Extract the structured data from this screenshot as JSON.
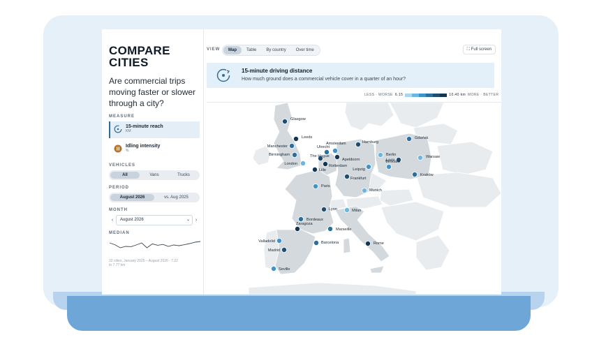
{
  "page": {
    "title": "COMPARE CITIES",
    "question": "Are commercial trips moving faster or slower through a city?"
  },
  "measure": {
    "label": "MEASURE",
    "items": [
      {
        "name": "15-minute reach",
        "unit": "KM",
        "active": true,
        "icon": "clock-arrow-icon",
        "color": "#2f6d99"
      },
      {
        "name": "Idling intensity",
        "unit": "%",
        "active": false,
        "icon": "pause-icon",
        "color": "#b8742a"
      }
    ]
  },
  "vehicles": {
    "label": "VEHICLES",
    "options": [
      "All",
      "Vans",
      "Trucks"
    ],
    "selected": "All"
  },
  "period": {
    "label": "PERIOD",
    "options": [
      "August 2026",
      "vs. Aug 2025"
    ],
    "selected": "August 2026"
  },
  "month": {
    "label": "MONTH",
    "value": "August 2026",
    "prev": "‹",
    "next": "›",
    "dropdown": "⌄"
  },
  "median": {
    "label": "MEDIAN",
    "note": "32 cities, January 2025 – August 2026 · 7.22 to 7.77 km",
    "trend": [
      0.35,
      0.48,
      0.7,
      0.6,
      0.62,
      0.5,
      0.35,
      0.7,
      0.42,
      0.52,
      0.46,
      0.6,
      0.5,
      0.55,
      0.48,
      0.4,
      0.3,
      0.25
    ]
  },
  "view": {
    "label": "VIEW",
    "tabs": [
      "Map",
      "Table",
      "By country",
      "Over time"
    ],
    "selected": "Map",
    "fullscreen": "Full screen"
  },
  "banner": {
    "title": "15-minute driving distance",
    "description": "How much ground does a commercial vehicle cover in a quarter of an hour?"
  },
  "legend": {
    "left": "LESS · WORSE",
    "min": "6.15",
    "max": "10.40 km",
    "right": "MORE · BETTER",
    "colors": [
      "#a9d6ef",
      "#6cb7e2",
      "#3e93c8",
      "#2b6f9c",
      "#1d4e72",
      "#123652"
    ]
  },
  "cities": [
    {
      "name": "Glasgow",
      "level": 4
    },
    {
      "name": "Leeds",
      "level": 5
    },
    {
      "name": "Manchester",
      "level": 3
    },
    {
      "name": "Birmingham",
      "level": 3
    },
    {
      "name": "London",
      "level": 1
    },
    {
      "name": "Utrecht",
      "level": 3
    },
    {
      "name": "Amsterdam",
      "level": 2
    },
    {
      "name": "The Hague",
      "level": 4
    },
    {
      "name": "Rotterdam",
      "level": 5
    },
    {
      "name": "Apeldoorn",
      "level": 5
    },
    {
      "name": "Lille",
      "level": 5
    },
    {
      "name": "Hamburg",
      "level": 4
    },
    {
      "name": "Berlin",
      "level": 1
    },
    {
      "name": "Gdańsk",
      "level": 3
    },
    {
      "name": "Łódź",
      "level": 4
    },
    {
      "name": "Warsaw",
      "level": 1
    },
    {
      "name": "Wrocław",
      "level": 2
    },
    {
      "name": "Leipzig",
      "level": 2
    },
    {
      "name": "Kraków",
      "level": 3
    },
    {
      "name": "Frankfurt",
      "level": 4
    },
    {
      "name": "Paris",
      "level": 2
    },
    {
      "name": "Munich",
      "level": 1
    },
    {
      "name": "Lyon",
      "level": 4
    },
    {
      "name": "Milan",
      "level": 1
    },
    {
      "name": "Bordeaux",
      "level": 3
    },
    {
      "name": "Marseille",
      "level": 3
    },
    {
      "name": "Rome",
      "level": 5
    },
    {
      "name": "Zaragoza",
      "level": 5
    },
    {
      "name": "Valladolid",
      "level": 2
    },
    {
      "name": "Barcelona",
      "level": 3
    },
    {
      "name": "Madrid",
      "level": 4
    },
    {
      "name": "Seville",
      "level": 2
    }
  ]
}
